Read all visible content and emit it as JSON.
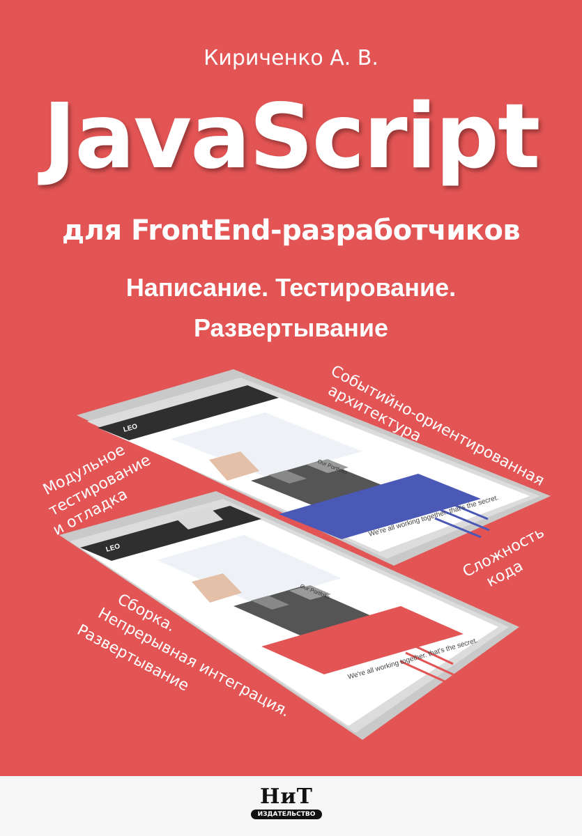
{
  "cover": {
    "author": "Кириченко А. В.",
    "title": "JavaScript",
    "subtitle": "для FrontEnd-разработчиков",
    "tagline_line1": "Написание. Тестирование.",
    "tagline_line2": "Развертывание",
    "features": {
      "f1_line1": "Событийно-ориентированная",
      "f1_line2": "архитектура",
      "f2_line1": "Модульное",
      "f2_line2": "тестирование",
      "f2_line3": "и отладка",
      "f3_line1": "Сложность",
      "f3_line2": "кода",
      "f4_line1": "Сборка.",
      "f4_line2": "Непрерывная интеграция.",
      "f4_line3": "Развертывание"
    },
    "mockup_text": {
      "brand": "LEO",
      "portfolio": "Our Portfolio",
      "slogan": "We're all working together. that's the secret."
    },
    "publisher": {
      "logo": "НиТ",
      "label": "ИЗДАТЕЛЬСТВО"
    },
    "colors": {
      "background": "#e35454",
      "mockup_blue": "#4a58b6",
      "mockup_red": "#e35454",
      "dark_header": "#2f2f2f"
    }
  }
}
